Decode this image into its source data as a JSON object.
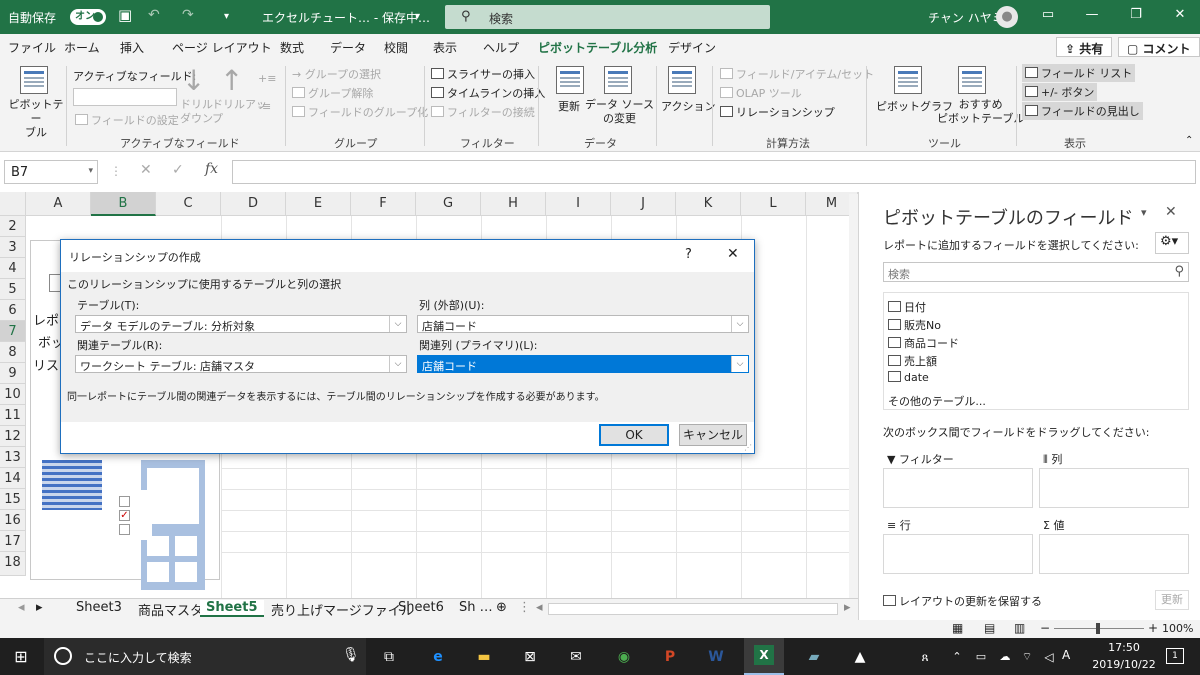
{
  "titlebar": {
    "autosave_label": "自動保存",
    "autosave_state": "オン",
    "doc_title": "エクセルチュート…  -  保存中…",
    "search_placeholder": "検索",
    "user_name": "チャン ハヤミ"
  },
  "tabs": [
    "ファイル",
    "ホーム",
    "挿入",
    "ページ レイアウト",
    "数式",
    "データ",
    "校閲",
    "表示",
    "ヘルプ",
    "ピボットテーブル分析",
    "デザイン"
  ],
  "active_tab": "ピボットテーブル分析",
  "share_label": "共有",
  "comment_label": "コメント",
  "ribbon": {
    "pivot_label": "ピボットテー\nブル",
    "active_field_label": "アクティブなフィールド:",
    "field_settings": "フィールドの設定",
    "drilldown": "ドリル\nダウン",
    "drillup": "ドリルアッ\nプ",
    "group_selection": "グループの選択",
    "ungroup": "グループ解除",
    "group_field": "フィールドのグループ化",
    "slicer": "スライサーの挿入",
    "timeline": "タイムラインの挿入",
    "filter_connections": "フィルターの接続",
    "refresh": "更新",
    "change_source": "データ ソース\nの変更",
    "actions": "アクション",
    "fields_items_sets": "フィールド/アイテム/セット",
    "olap_tools": "OLAP ツール",
    "relationships": "リレーションシップ",
    "pivot_chart": "ピボットグラフ",
    "recommended": "おすすめ\nピボットテーブル",
    "field_list": "フィールド リスト",
    "buttons": "+/- ボタン",
    "field_headers": "フィールドの見出し",
    "groups": [
      "アクティブなフィールド",
      "グループ",
      "フィルター",
      "データ",
      "計算方法",
      "ツール",
      "表示"
    ]
  },
  "namebox": "B7",
  "grid": {
    "columns": [
      "A",
      "B",
      "C",
      "D",
      "E",
      "F",
      "G",
      "H",
      "I",
      "J",
      "K",
      "L",
      "M"
    ],
    "rows": [
      "2",
      "3",
      "4",
      "5",
      "6",
      "7",
      "8",
      "9",
      "10",
      "11",
      "12",
      "13",
      "14",
      "15",
      "16",
      "17",
      "18"
    ],
    "cell_fragments": [
      "レポ",
      "ボッ",
      "リス"
    ]
  },
  "sheets": [
    "Sheet3",
    "商品マスタ",
    "Sheet5",
    "売り上げマージファイル",
    "Sheet6",
    "Sh …"
  ],
  "active_sheet": "Sheet5",
  "pane": {
    "title": "ピボットテーブルのフィールド",
    "subtitle": "レポートに追加するフィールドを選択してください:",
    "search_placeholder": "検索",
    "fields": [
      "日付",
      "販売No",
      "商品コード",
      "売上額",
      "date"
    ],
    "more_tables": "その他のテーブル...",
    "drag_hint": "次のボックス間でフィールドをドラッグしてください:",
    "area_filter": "フィルター",
    "area_columns": "列",
    "area_rows": "行",
    "area_values": "値",
    "defer_label": "レイアウトの更新を保留する",
    "update_button": "更新"
  },
  "dialog": {
    "title": "リレーションシップの作成",
    "help": "?",
    "section": "このリレーションシップに使用するテーブルと列の選択",
    "table_label": "テーブル(T):",
    "table_value": "データ モデルのテーブル: 分析対象",
    "column_label": "列 (外部)(U):",
    "column_value": "店舗コード",
    "related_table_label": "関連テーブル(R):",
    "related_table_value": "ワークシート テーブル: 店舗マスタ",
    "related_column_label": "関連列 (プライマリ)(L):",
    "related_column_value": "店舗コード",
    "info": "同一レポートにテーブル間の関連データを表示するには、テーブル間のリレーションシップを作成する必要があります。",
    "ok": "OK",
    "cancel": "キャンセル"
  },
  "statusbar": {
    "zoom": "100%"
  },
  "taskbar": {
    "search_placeholder": "ここに入力して検索",
    "time": "17:50",
    "date": "2019/10/22",
    "ime": "A",
    "notification_count": "1"
  },
  "colors": {
    "excel_green": "#217346",
    "dialog_blue": "#0078d7",
    "taskbar": "#1f1f1f"
  }
}
